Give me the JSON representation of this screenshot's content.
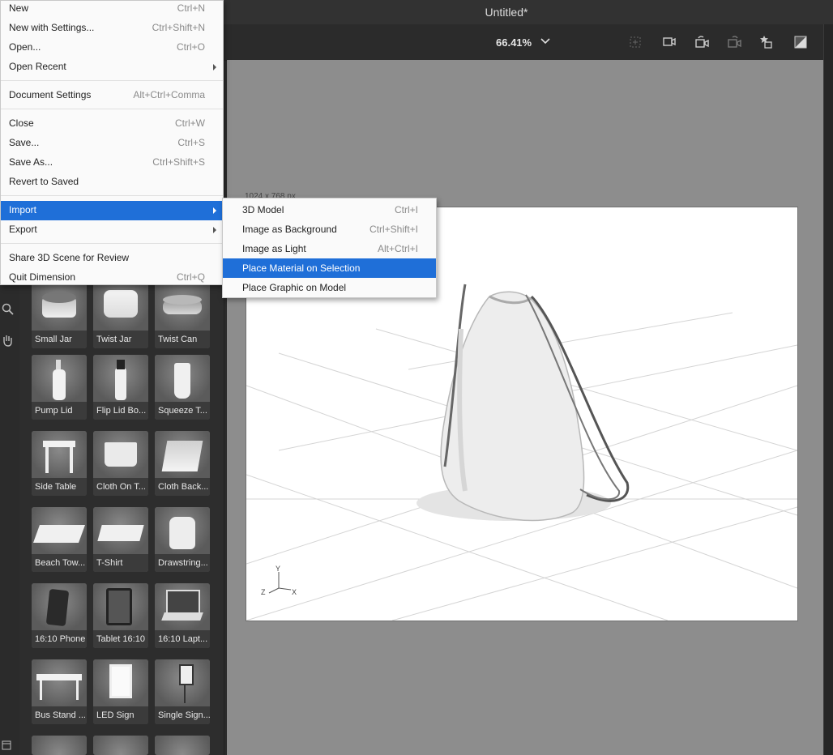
{
  "window": {
    "title": "Untitled*"
  },
  "toolbar": {
    "zoom": "66.41%"
  },
  "canvas": {
    "doc_size": "1024 x 768 px"
  },
  "file_menu": {
    "items": [
      {
        "label": "New",
        "shortcut": "Ctrl+N"
      },
      {
        "label": "New with Settings...",
        "shortcut": "Ctrl+Shift+N"
      },
      {
        "label": "Open...",
        "shortcut": "Ctrl+O"
      },
      {
        "label": "Open Recent",
        "shortcut": ""
      },
      {
        "label": "Document Settings",
        "shortcut": "Alt+Ctrl+Comma"
      },
      {
        "label": "Close",
        "shortcut": "Ctrl+W"
      },
      {
        "label": "Save...",
        "shortcut": "Ctrl+S"
      },
      {
        "label": "Save As...",
        "shortcut": "Ctrl+Shift+S"
      },
      {
        "label": "Revert to Saved",
        "shortcut": ""
      },
      {
        "label": "Import",
        "shortcut": ""
      },
      {
        "label": "Export",
        "shortcut": ""
      },
      {
        "label": "Share 3D Scene for Review",
        "shortcut": ""
      },
      {
        "label": "Quit Dimension",
        "shortcut": "Ctrl+Q"
      }
    ]
  },
  "import_menu": {
    "items": [
      {
        "label": "3D Model",
        "shortcut": "Ctrl+I"
      },
      {
        "label": "Image as Background",
        "shortcut": "Ctrl+Shift+I"
      },
      {
        "label": "Image as Light",
        "shortcut": "Alt+Ctrl+I"
      },
      {
        "label": "Place Material on Selection",
        "shortcut": ""
      },
      {
        "label": "Place Graphic on Model",
        "shortcut": ""
      }
    ]
  },
  "assets": {
    "tiles": [
      {
        "label": "Small Jar"
      },
      {
        "label": "Twist Jar"
      },
      {
        "label": "Twist Can"
      },
      {
        "label": "Pump Lid"
      },
      {
        "label": "Flip Lid Bo..."
      },
      {
        "label": "Squeeze T..."
      },
      {
        "label": "Side Table"
      },
      {
        "label": "Cloth On T..."
      },
      {
        "label": "Cloth Back..."
      },
      {
        "label": "Beach Tow..."
      },
      {
        "label": "T-Shirt"
      },
      {
        "label": "Drawstring..."
      },
      {
        "label": "16:10 Phone"
      },
      {
        "label": "Tablet 16:10"
      },
      {
        "label": "16:10 Lapt..."
      },
      {
        "label": "Bus Stand ..."
      },
      {
        "label": "LED Sign"
      },
      {
        "label": "Single Sign..."
      }
    ]
  },
  "axes": {
    "y": "Y",
    "z": "Z",
    "x": "X"
  }
}
